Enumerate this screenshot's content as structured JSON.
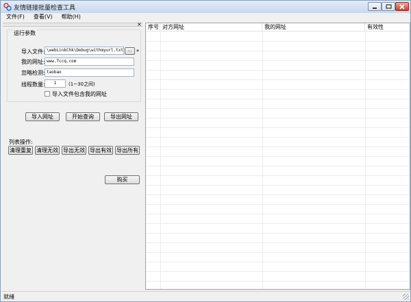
{
  "window": {
    "title": "友情链接批量检查工具",
    "min_icon": "minimize-icon",
    "max_icon": "maximize-icon",
    "close_icon": "close-icon"
  },
  "menu": [
    "文件(F)",
    "查看(V)",
    "帮助(H)"
  ],
  "panel": {
    "close_glyph": "×",
    "group_title": "运行参数",
    "import_file_label": "导入文件:",
    "import_file_value": "\\webLinkChk\\Debug\\withmyurl.txt",
    "browse_label": "...",
    "required_mark": "*",
    "my_url_label": "我的网址:",
    "my_url_value": "www.Tccq.com",
    "ignore_label": "忽略检测:",
    "ignore_value": "taobao",
    "threads_label": "线程数量:",
    "threads_value": "1",
    "threads_hint": "(1~30之间)",
    "checkbox_label": "导入文件包含我的网址",
    "checkbox_checked": false,
    "import_button": "导入网址",
    "start_button": "开始查询",
    "export_button": "导出网址",
    "list_ops_label": "列表操作:",
    "list_ops": [
      "清理重复",
      "清理无效",
      "导出无效",
      "导出有效",
      "导出所有"
    ],
    "buy_button": "购买"
  },
  "list": {
    "columns": [
      "序号",
      "对方网址",
      "我的网址",
      "有效性"
    ]
  },
  "status": {
    "text": "就绪"
  },
  "colors": {
    "title_gradient_top": "#e3ecf7",
    "close_button": "#c7412b",
    "grid_line": "#ececec"
  }
}
